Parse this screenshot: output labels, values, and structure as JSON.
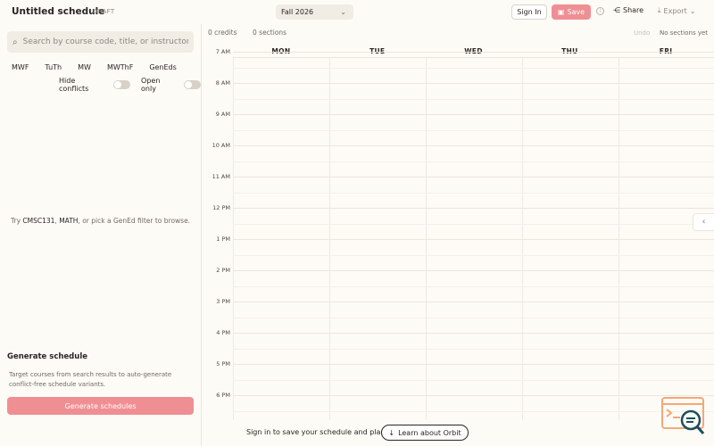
{
  "header": {
    "title": "Untitled schedule",
    "draft_badge": "DRAFT",
    "term": "Fall 2026",
    "sign_in": "Sign In",
    "save": "Save",
    "share": "Share",
    "export": "Export"
  },
  "sidebar": {
    "search_placeholder": "Search by course code, title, or instructor",
    "filters": [
      "MWF",
      "TuTh",
      "MW",
      "MWThF",
      "GenEds"
    ],
    "hide_conflicts": "Hide conflicts",
    "open_only": "Open only",
    "hint_prefix": "Try ",
    "hint_code1": "CMSC131",
    "hint_sep": ", ",
    "hint_code2": "MATH",
    "hint_suffix": ", or pick a GenEd filter to browse.",
    "generate_title": "Generate schedule",
    "generate_desc": "Target courses from search results to auto-generate conflict-free schedule variants.",
    "generate_button": "Generate schedules"
  },
  "calendar": {
    "credits": "0 credits",
    "sections": "0 sections",
    "undo": "Undo",
    "no_sections": "No sections yet",
    "days": [
      "MON",
      "TUE",
      "WED",
      "THU",
      "FRI"
    ],
    "times": [
      "7 AM",
      "8 AM",
      "9 AM",
      "10 AM",
      "11 AM",
      "12 PM",
      "1 PM",
      "2 PM",
      "3 PM",
      "4 PM",
      "5 PM",
      "6 PM"
    ]
  },
  "footer": {
    "message": "Sign in to save your schedule and plan.",
    "learn_button": "Learn about Orbit"
  },
  "colors": {
    "accent": "#ef8f93",
    "background": "#fdfbf6",
    "logo": "#f4a876"
  }
}
